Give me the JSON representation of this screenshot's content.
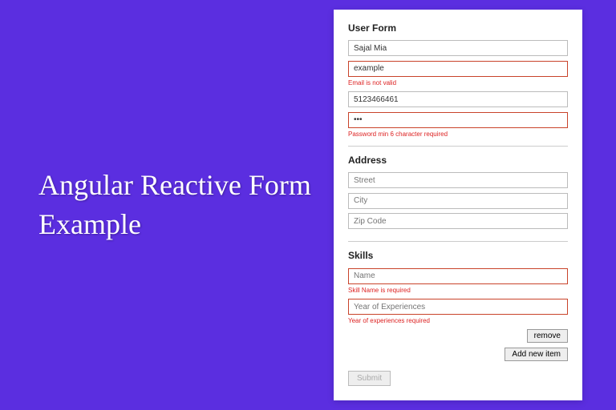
{
  "heading": "Angular Reactive Form Example",
  "form": {
    "user": {
      "title": "User Form",
      "name_value": "Sajal Mia",
      "email_value": "example",
      "email_error": "Email is not valid",
      "phone_value": "5123466461",
      "password_value": "•••",
      "password_error": "Password min 6 character required"
    },
    "address": {
      "title": "Address",
      "street_placeholder": "Street",
      "city_placeholder": "City",
      "zip_placeholder": "Zip Code"
    },
    "skills": {
      "title": "Skills",
      "name_placeholder": "Name",
      "name_error": "Skill Name is required",
      "year_placeholder": "Year of Experiences",
      "year_error": "Year of experiences required",
      "remove_label": "remove",
      "add_label": "Add new item"
    },
    "submit_label": "Submit"
  }
}
